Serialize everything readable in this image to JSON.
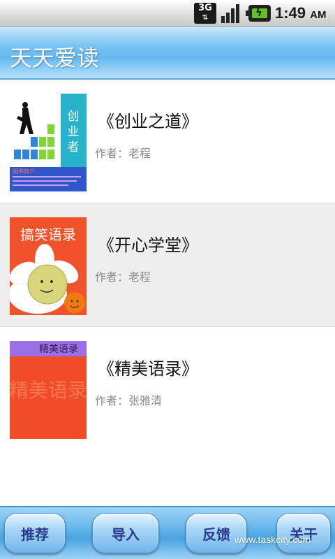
{
  "status_bar": {
    "network": "3G",
    "time": "1:49",
    "ampm": "AM",
    "signal_icon": "signal-bars-icon",
    "battery_icon": "battery-charging-icon"
  },
  "app": {
    "title": "天天爱读"
  },
  "books": [
    {
      "title": "《创业之道》",
      "author": "作者：老程",
      "cover_text": "创业者",
      "cover_caption": "图书简介"
    },
    {
      "title": "《开心学堂》",
      "author": "作者：老程",
      "cover_text": "搞笑语录"
    },
    {
      "title": "《精美语录》",
      "author": "作者：张雅清",
      "cover_text": "精美语录",
      "cover_big_text": "精美语录"
    }
  ],
  "bottom_nav": {
    "recommend": "推荐",
    "import": "导入",
    "feedback": "反馈",
    "about": "关于"
  },
  "watermark": "www.taskcity.com",
  "colors": {
    "title_bar": "#63b7ee",
    "bottom_bar": "#4aa3e0",
    "button_text": "#2a3a8c"
  }
}
